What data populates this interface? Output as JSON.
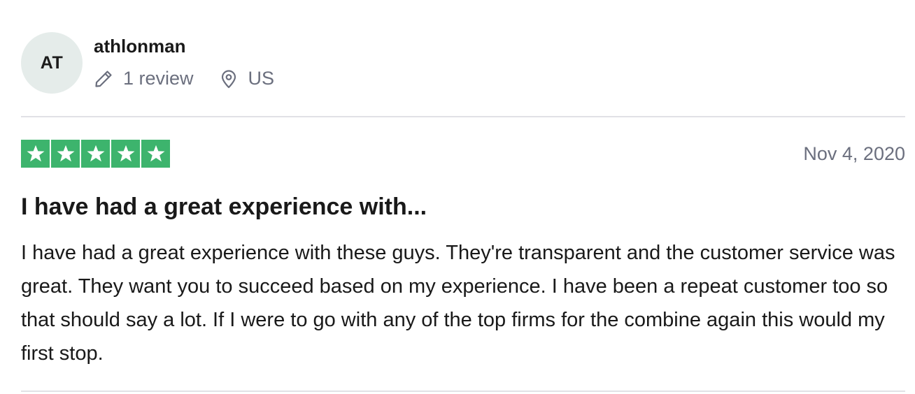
{
  "consumer": {
    "initials": "AT",
    "name": "athlonman",
    "review_count": "1 review",
    "country": "US"
  },
  "review": {
    "rating": 5,
    "rating_label": "Rated 5 out of 5 stars",
    "date": "Nov 4, 2020",
    "title": "I have had a great experience with...",
    "text": "I have had a great experience with these guys. They're transparent and the customer service was great. They want you to succeed based on my experience. I have been a repeat customer too so that should say a lot. If I were to go with any of the top firms for the combine again this would my first stop."
  },
  "icons": {
    "review_count": "pencil-icon",
    "country": "location-pin-icon",
    "rating": "star-icon"
  },
  "colors": {
    "star_green": "#3db46d",
    "avatar_bg": "#e5ecea",
    "meta_gray": "#6b6f7e",
    "divider": "#e1e1e6",
    "text": "#191919"
  }
}
